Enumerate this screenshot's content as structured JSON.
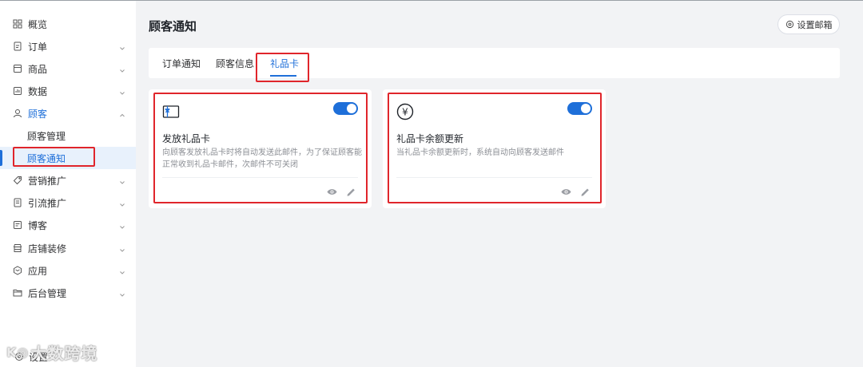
{
  "sidebar": {
    "items": [
      {
        "label": "概览",
        "icon": "overview-icon"
      },
      {
        "label": "订单",
        "icon": "order-icon"
      },
      {
        "label": "商品",
        "icon": "product-icon"
      },
      {
        "label": "数据",
        "icon": "data-icon"
      },
      {
        "label": "顾客",
        "icon": "customer-icon"
      },
      {
        "label": "营销推广",
        "icon": "tag-icon"
      },
      {
        "label": "引流推广",
        "icon": "traffic-icon"
      },
      {
        "label": "博客",
        "icon": "blog-icon"
      },
      {
        "label": "店铺装修",
        "icon": "store-icon"
      },
      {
        "label": "应用",
        "icon": "app-icon"
      },
      {
        "label": "后台管理",
        "icon": "folder-icon"
      }
    ],
    "customer_sub": [
      {
        "label": "顾客管理"
      },
      {
        "label": "顾客通知"
      }
    ],
    "footer_settings": "设置"
  },
  "watermark": "大数跨境",
  "header": {
    "title": "顾客通知",
    "settings_mail_label": "设置邮箱"
  },
  "tabs": [
    {
      "label": "订单通知"
    },
    {
      "label": "顾客信息"
    },
    {
      "label": "礼品卡"
    }
  ],
  "cards": [
    {
      "title": "发放礼品卡",
      "description": "向顾客发放礼品卡时将自动发送此邮件，为了保证顾客能正常收到礼品卡邮件，次邮件不可关闭",
      "enabled": true
    },
    {
      "title": "礼品卡余额更新",
      "description": "当礼品卡余额更新时，系统自动向顾客发送邮件",
      "enabled": true
    }
  ],
  "colors": {
    "accent": "#1e6fd9",
    "highlight_box": "#e0252b",
    "background": "#f2f3f5"
  }
}
